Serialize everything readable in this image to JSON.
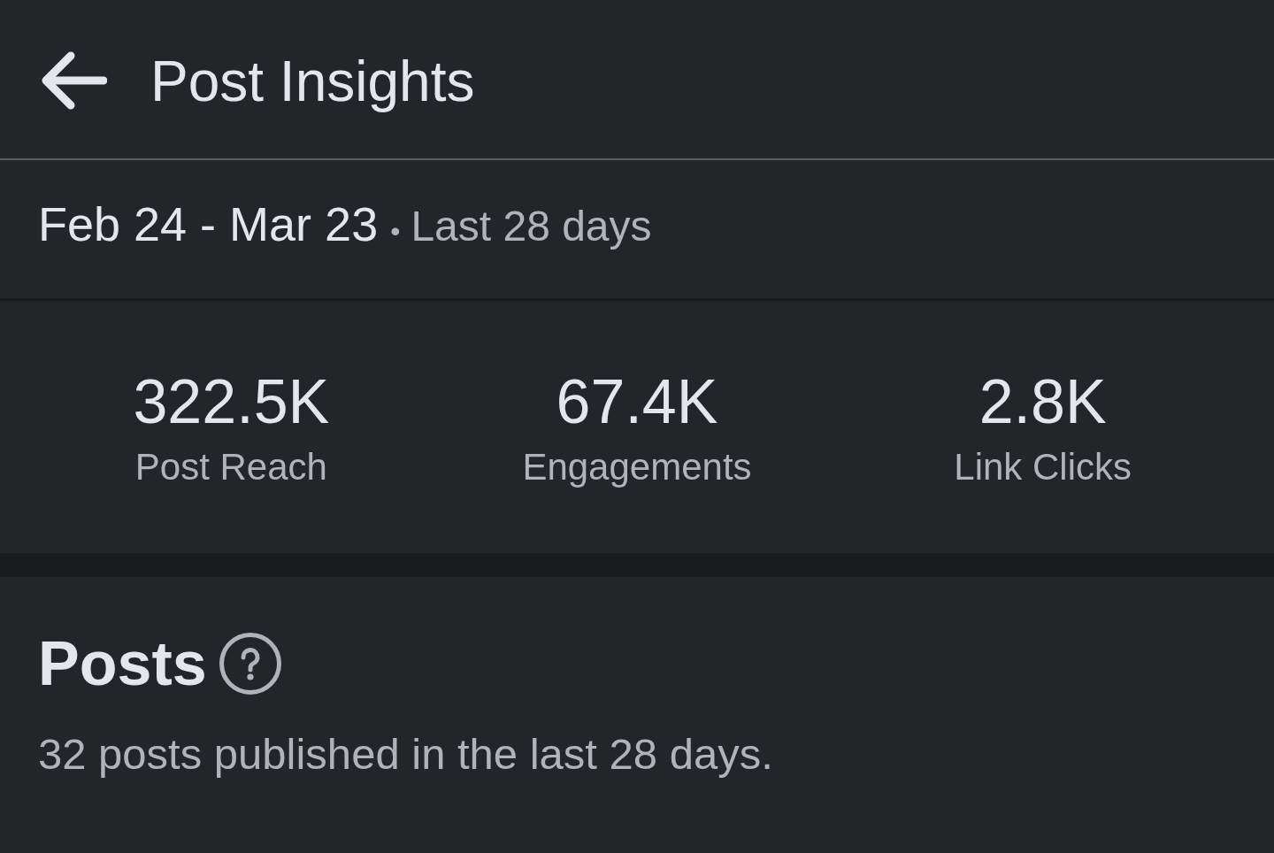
{
  "header": {
    "title": "Post Insights"
  },
  "date_range": {
    "range": "Feb 24 - Mar 23",
    "separator": "•",
    "period": "Last 28 days"
  },
  "metrics": [
    {
      "value": "322.5K",
      "label": "Post Reach"
    },
    {
      "value": "67.4K",
      "label": "Engagements"
    },
    {
      "value": "2.8K",
      "label": "Link Clicks"
    }
  ],
  "posts": {
    "title": "Posts",
    "description": "32 posts published in the last 28 days."
  }
}
